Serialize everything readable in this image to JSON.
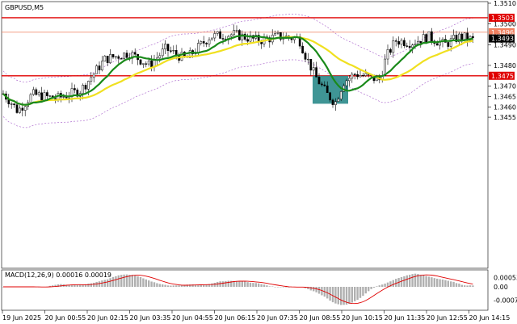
{
  "header": {
    "symbol_label": "GBPUSD,M5"
  },
  "price_axis": {
    "ticks": [
      "1.3510",
      "1.3500",
      "1.3490",
      "1.3480",
      "1.3470",
      "1.3465",
      "1.3460",
      "1.3455"
    ],
    "tick_values": [
      1.351,
      1.35,
      1.349,
      1.348,
      1.347,
      1.3465,
      1.346,
      1.3455
    ]
  },
  "levels": [
    {
      "label": "1.3503",
      "value": 1.3503,
      "color": "#e00000"
    },
    {
      "label": "1.3496",
      "value": 1.3496,
      "color": "#f08060"
    },
    {
      "label": "1.3475",
      "value": 1.3475,
      "color": "#e00000"
    }
  ],
  "current_price": {
    "label": "1.3493",
    "value": 1.3493
  },
  "macd": {
    "label": "MACD(12,26,9) 0.00016 0.00019",
    "ticks": [
      "0.00053",
      "0.00",
      "-0.00076"
    ],
    "tick_values": [
      0.00053,
      0,
      -0.00076
    ]
  },
  "time_axis": {
    "labels": [
      "19 Jun 2025",
      "20 Jun 00:55",
      "20 Jun 02:15",
      "20 Jun 03:35",
      "20 Jun 04:55",
      "20 Jun 06:15",
      "20 Jun 07:35",
      "20 Jun 08:55",
      "20 Jun 10:15",
      "20 Jun 11:35",
      "20 Jun 12:55",
      "20 Jun 14:15"
    ]
  },
  "colors": {
    "ma_fast": "#1a8a1a",
    "ma_slow": "#f0e020",
    "bollinger": "#b070d0",
    "highlight_box": "#2a8a8a",
    "candle": "#000000",
    "macd_hist": "#b0b0b0",
    "macd_signal": "#e00000"
  }
}
